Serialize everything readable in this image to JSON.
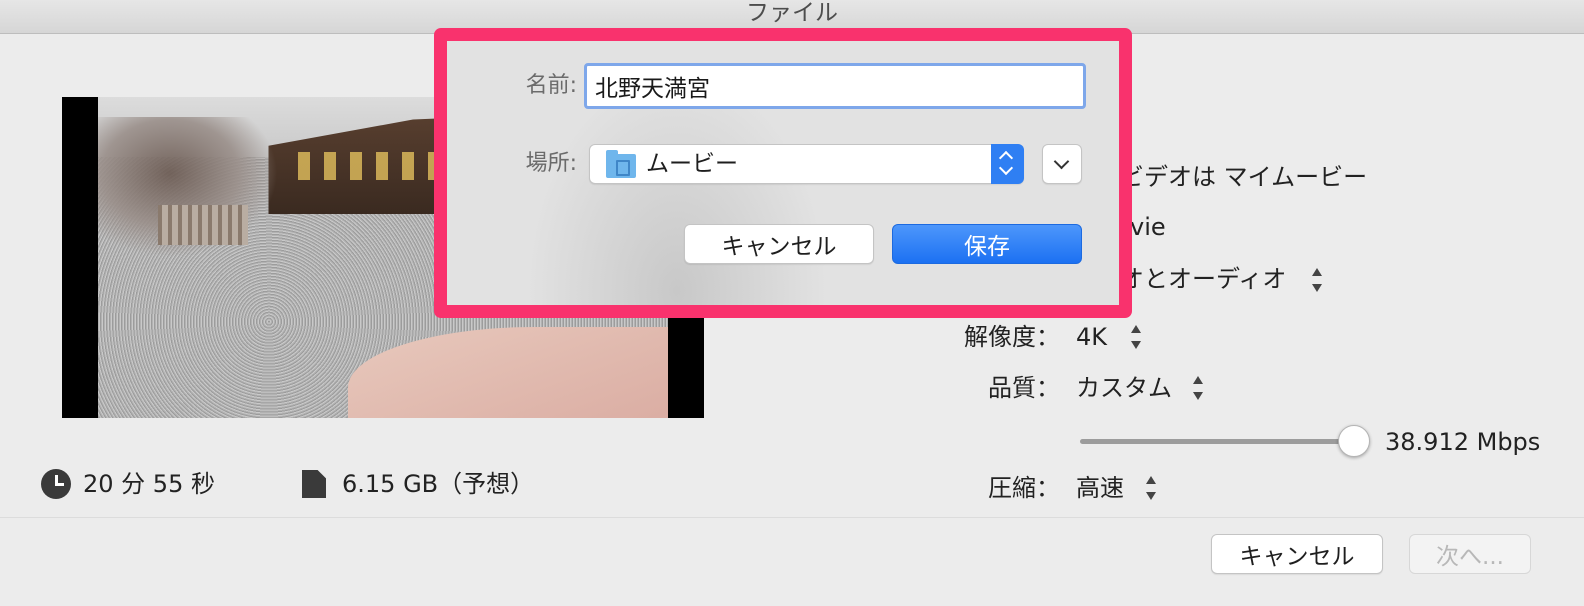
{
  "window": {
    "title": "ファイル"
  },
  "info": {
    "duration": "20 分 55 秒",
    "size": "6.15 GB（予想）"
  },
  "settings": {
    "format_value_partial": "ビデオは マイムービー",
    "movie_partial": "vie",
    "audio_partial": "オとオーディオ",
    "resolution_label": "解像度：",
    "resolution_value": "4K",
    "quality_label": "品質：",
    "quality_value": "カスタム",
    "bitrate": "38.912 Mbps",
    "bitrate_slider_fraction": 0.98,
    "compression_label": "圧縮：",
    "compression_value": "高速"
  },
  "footer": {
    "cancel_label": "キャンセル",
    "next_label": "次へ..."
  },
  "save_sheet": {
    "name_label": "名前:",
    "name_value": "北野天満宮",
    "location_label": "場所:",
    "location_value": "ムービー",
    "cancel_label": "キャンセル",
    "save_label": "保存"
  },
  "colors": {
    "highlight": "#f9326d",
    "accent": "#1c71f2"
  }
}
